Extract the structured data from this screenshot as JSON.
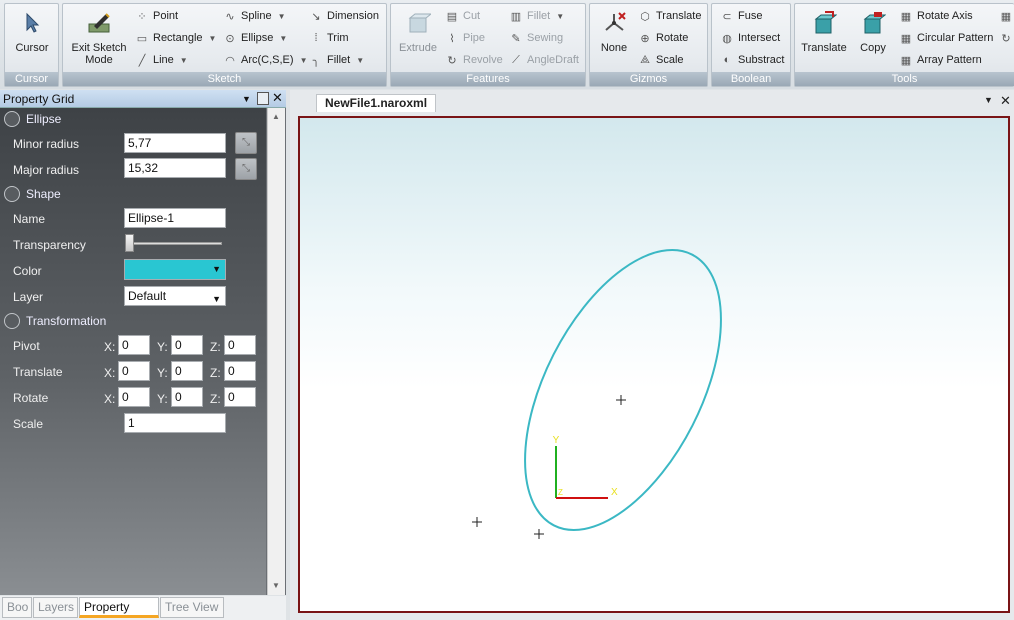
{
  "ribbon": {
    "groups": {
      "cursor": "Cursor",
      "sketch": "Sketch",
      "features": "Features",
      "gizmos": "Gizmos",
      "boolean": "Boolean",
      "tools": "Tools"
    },
    "cursor_btn": "Cursor",
    "exit_sketch_line1": "Exit Sketch",
    "exit_sketch_line2": "Mode",
    "sketch_items": {
      "point": "Point",
      "rectangle": "Rectangle",
      "line": "Line",
      "spline": "Spline",
      "ellipse": "Ellipse",
      "arc": "Arc(C,S,E)",
      "dimension": "Dimension",
      "trim": "Trim",
      "fillet": "Fillet"
    },
    "feature_items": {
      "extrude": "Extrude",
      "cut": "Cut",
      "pipe": "Pipe",
      "revolve": "Revolve",
      "fillet": "Fillet",
      "sewing": "Sewing",
      "angledraft": "AngleDraft"
    },
    "gizmo_items": {
      "none": "None",
      "translate": "Translate",
      "rotate": "Rotate",
      "scale": "Scale"
    },
    "boolean_items": {
      "fuse": "Fuse",
      "intersect": "Intersect",
      "substract": "Substract"
    },
    "tool_items": {
      "translate": "Translate",
      "copy": "Copy",
      "rotate_axis": "Rotate Axis",
      "circular_pattern": "Circular Pattern",
      "array_pattern": "Array Pattern"
    }
  },
  "property_grid": {
    "title": "Property Grid",
    "ellipse_section": "Ellipse",
    "minor_radius_label": "Minor radius",
    "minor_radius_value": "5,77",
    "major_radius_label": "Major radius",
    "major_radius_value": "15,32",
    "shape_section": "Shape",
    "name_label": "Name",
    "name_value": "Ellipse-1",
    "transparency_label": "Transparency",
    "transparency_value": 0,
    "color_label": "Color",
    "color_value": "#29c6d2",
    "layer_label": "Layer",
    "layer_value": "Default",
    "transformation_section": "Transformation",
    "pivot_label": "Pivot",
    "translate_label": "Translate",
    "rotate_label": "Rotate",
    "scale_label": "Scale",
    "x": "X:",
    "y": "Y:",
    "z": "Z:",
    "pivot": [
      "0",
      "0",
      "0"
    ],
    "translate": [
      "0",
      "0",
      "0"
    ],
    "rotate": [
      "0",
      "0",
      "0"
    ],
    "scale_value": "1"
  },
  "bottom_tabs": [
    "Boo",
    "Layers",
    "Property Grid",
    "Tree View"
  ],
  "document": {
    "tab_title": "NewFile1.naroxml"
  },
  "colors": {
    "ellipse": "#3bb8c4",
    "viewport_border": "#7a1416",
    "axis_x": "#d01010",
    "axis_y": "#20b020",
    "axis_label": "#e8e020"
  }
}
